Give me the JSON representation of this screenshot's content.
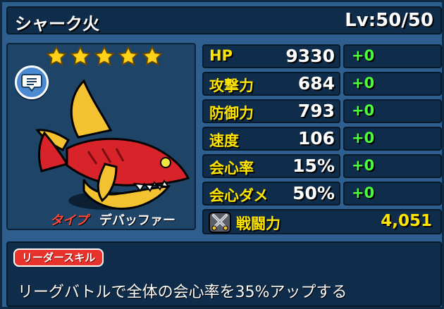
{
  "character": {
    "name": "シャーク火",
    "level": "Lv:50/50",
    "stars": 5,
    "type_label": "タイプ",
    "type_value": "デバッファー"
  },
  "stats": [
    {
      "label": "HP",
      "value": "9330",
      "bonus": "+0"
    },
    {
      "label": "攻撃力",
      "value": "684",
      "bonus": "+0"
    },
    {
      "label": "防御力",
      "value": "793",
      "bonus": "+0"
    },
    {
      "label": "速度",
      "value": "106",
      "bonus": "+0"
    },
    {
      "label": "会心率",
      "value": "15%",
      "bonus": "+0"
    },
    {
      "label": "会心ダメ",
      "value": "50%",
      "bonus": "+0"
    }
  ],
  "power": {
    "label": "戦闘力",
    "value": "4,051"
  },
  "leader_skill": {
    "tag": "リーダースキル",
    "description": "リーグバトルで全体の会心率を35%アップする"
  },
  "icons": {
    "star": "star-icon",
    "chat": "chat-bubble-icon",
    "power": "crossed-swords-icon"
  },
  "colors": {
    "stat_label": "#ffe600",
    "bonus": "#4dff3a",
    "skill_tag": "#e8322c",
    "type_label": "#ff4a3a"
  }
}
